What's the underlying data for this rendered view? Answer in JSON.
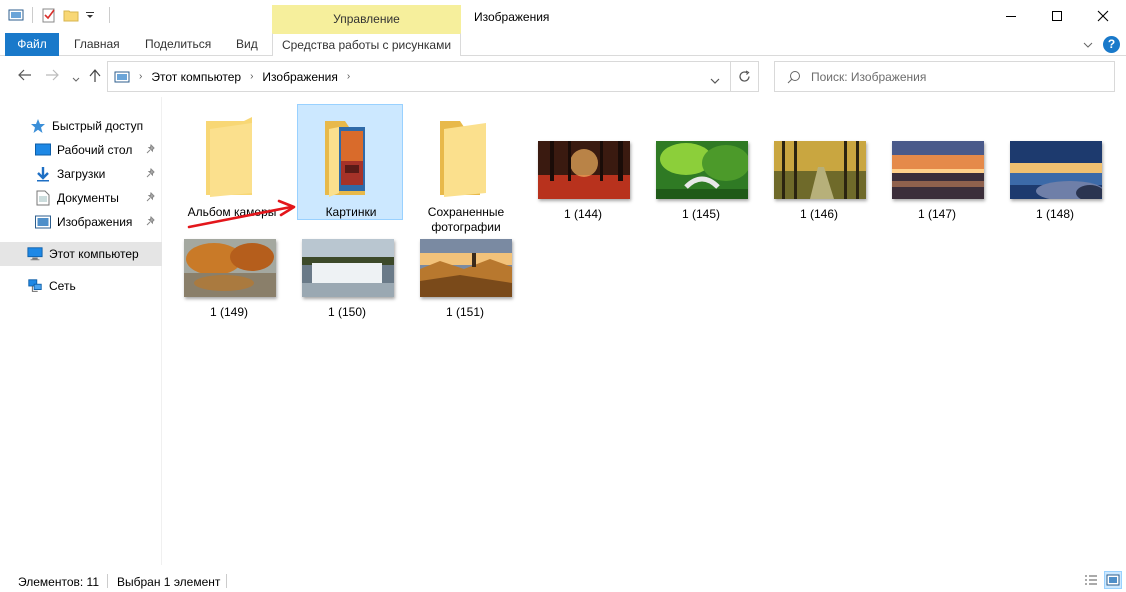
{
  "window": {
    "title": "Изображения",
    "context_group": "Управление",
    "controls": {
      "minimize": "—",
      "maximize": "☐",
      "close": "✕"
    }
  },
  "ribbon": {
    "tabs": [
      {
        "label": "Файл"
      },
      {
        "label": "Главная"
      },
      {
        "label": "Поделиться"
      },
      {
        "label": "Вид"
      },
      {
        "label": "Средства работы с рисунками"
      }
    ]
  },
  "address": {
    "breadcrumb": [
      "Этот компьютер",
      "Изображения"
    ],
    "search_placeholder": "Поиск: Изображения"
  },
  "nav": {
    "quick_access": "Быстрый доступ",
    "pinned": [
      {
        "label": "Рабочий стол",
        "icon": "desktop-icon"
      },
      {
        "label": "Загрузки",
        "icon": "download-icon"
      },
      {
        "label": "Документы",
        "icon": "documents-icon"
      },
      {
        "label": "Изображения",
        "icon": "pictures-icon"
      }
    ],
    "this_pc": "Этот компьютер",
    "network": "Сеть"
  },
  "items": {
    "folders": [
      {
        "label": "Альбом камеры",
        "selected": false
      },
      {
        "label": "Картинки",
        "selected": true
      },
      {
        "label": "Сохраненные фотографии",
        "selected": false
      }
    ],
    "images": [
      {
        "label": "1 (144)",
        "scene": "autumn-forest-red"
      },
      {
        "label": "1 (145)",
        "scene": "green-bridge"
      },
      {
        "label": "1 (146)",
        "scene": "birch-alley"
      },
      {
        "label": "1 (147)",
        "scene": "sunset-sea"
      },
      {
        "label": "1 (148)",
        "scene": "rocky-shore-dusk"
      },
      {
        "label": "1 (149)",
        "scene": "autumn-lake"
      },
      {
        "label": "1 (150)",
        "scene": "waterfall"
      },
      {
        "label": "1 (151)",
        "scene": "mountain-sunrise"
      }
    ]
  },
  "status": {
    "count": "Элементов: 11",
    "selection": "Выбран 1 элемент"
  },
  "colors": {
    "file_tab": "#1979ca",
    "context_tab": "#f6ef9c",
    "selection_bg": "#cce8ff",
    "selection_border": "#99d1ff",
    "folder_yellow": "#f8d775",
    "annotation_arrow": "#e3161b"
  }
}
